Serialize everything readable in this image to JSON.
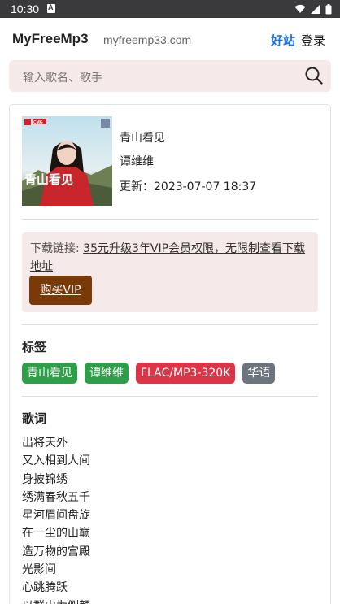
{
  "status_bar": {
    "time": "10:30",
    "notification_icon": "A"
  },
  "header": {
    "brand": "MyFreeMp3",
    "domain": "myfreemp33.com",
    "nav_good": "好站",
    "nav_login": "登录"
  },
  "search": {
    "placeholder": "输入歌名、歌手"
  },
  "song": {
    "title": "青山看见",
    "artist": "谭维维",
    "update_label": "更新：",
    "update_date": "2023-07-07 18:37"
  },
  "cover_text": {
    "badge": "CMG",
    "calligraphy": "青山看见"
  },
  "download": {
    "label": "下载链接: ",
    "link_text": "35元升级3年VIP会员权限，无限制查看下载地址",
    "vip_button": "购买VIP"
  },
  "tags_section": {
    "title": "标签",
    "tags": [
      {
        "label": "青山看见",
        "color": "#2e9e48"
      },
      {
        "label": "谭维维",
        "color": "#2e9e48"
      },
      {
        "label": "FLAC/MP3-320K",
        "color": "#dc3545"
      },
      {
        "label": "华语",
        "color": "#6c757d"
      }
    ]
  },
  "lyrics_section": {
    "title": "歌词",
    "lines": [
      "出将天外",
      "又入相到人间",
      "身披锦绣",
      "绣满春秋五千",
      "星河眉间盘旋",
      "在一尘的山巅",
      "造万物的宫殿",
      "光影间",
      "心跳腾跃",
      "以群山为侧颜"
    ]
  },
  "colors": {
    "accent": "#1a73e8",
    "vip_button": "#7a3a08",
    "search_bg": "#f5e9ea",
    "download_bg": "#f6e9ea"
  }
}
